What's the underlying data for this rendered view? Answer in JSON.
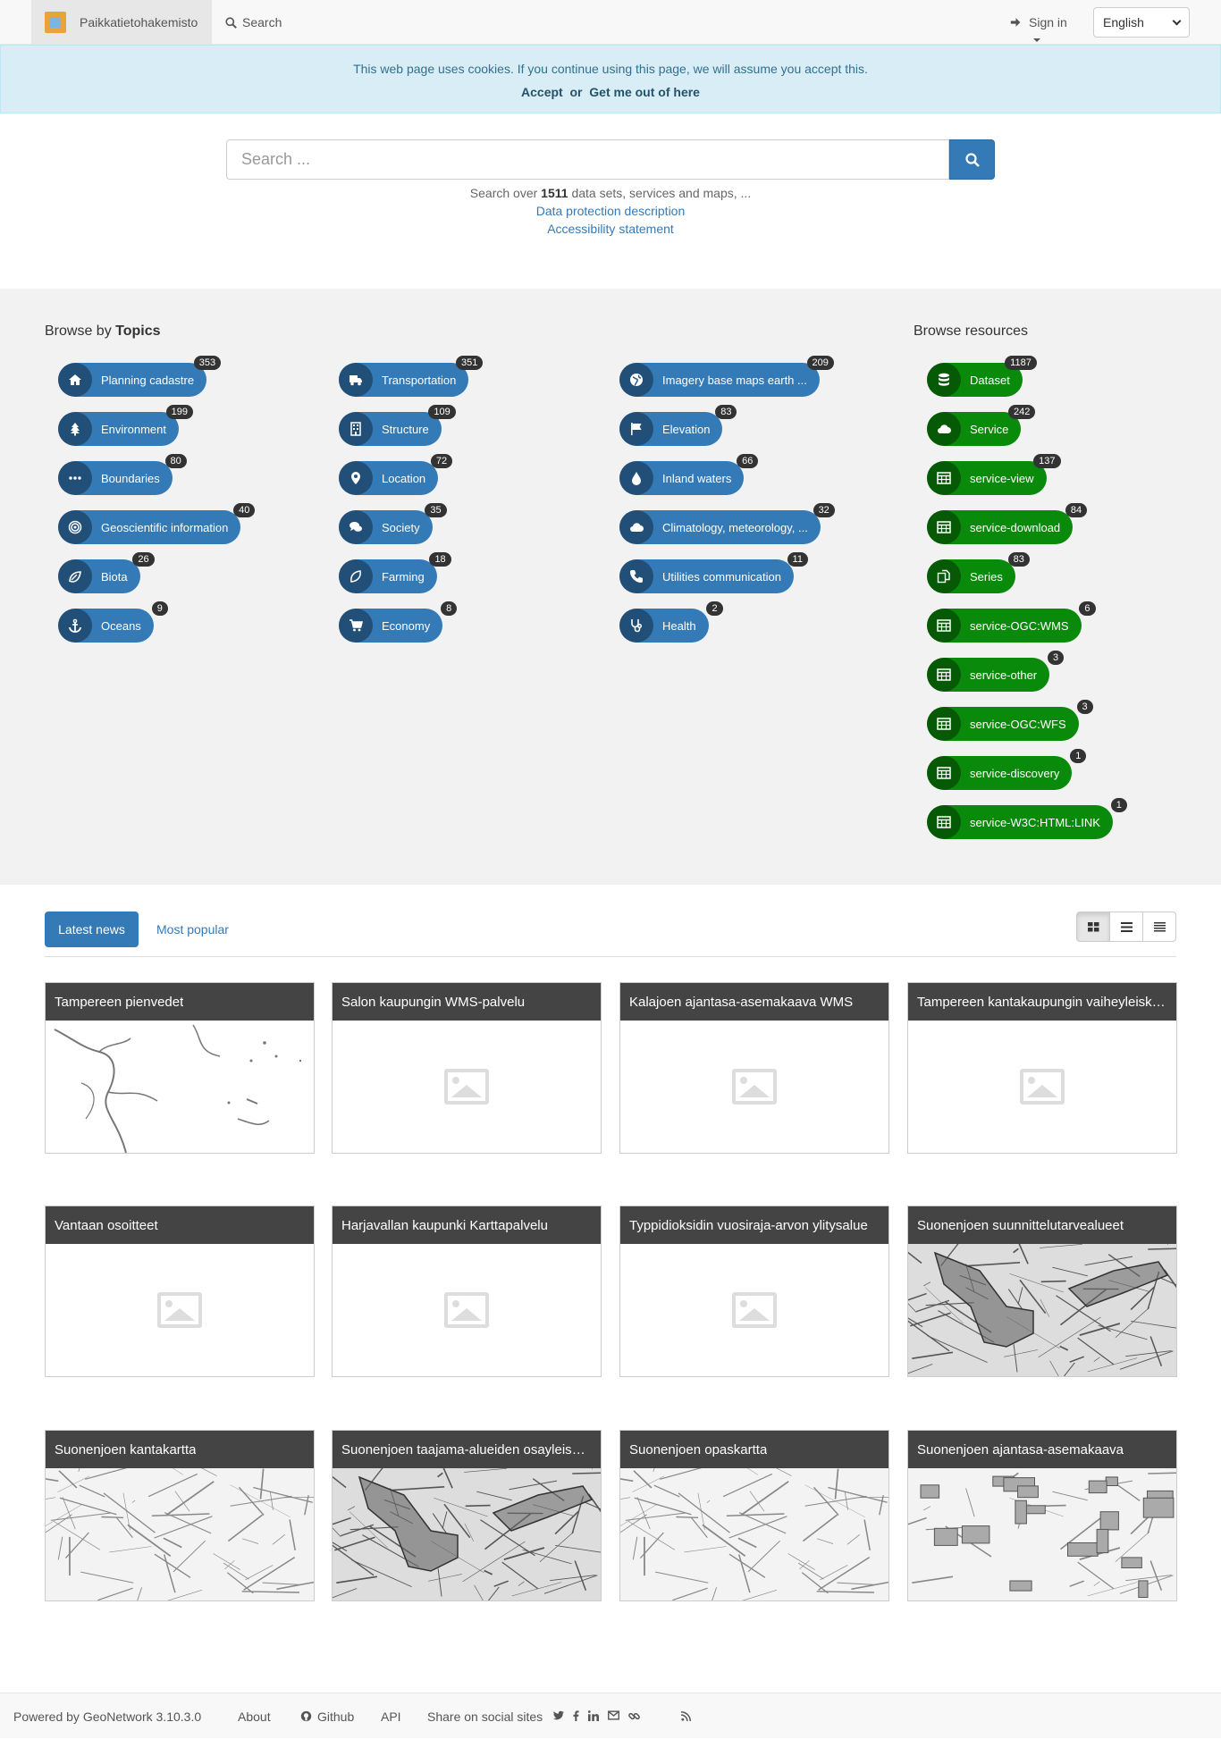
{
  "navbar": {
    "brand": "Paikkatietohakemisto",
    "search": "Search",
    "signin": "Sign in",
    "language": "English"
  },
  "cookie": {
    "message": "This web page uses cookies. If you continue using this page, we will assume you accept this.",
    "accept": "Accept",
    "or": "or",
    "leave": "Get me out of here"
  },
  "search": {
    "placeholder": "Search ...",
    "info_prefix": "Search over",
    "info_count": "1511",
    "info_suffix": "data sets, services and maps, ...",
    "data_protection": "Data protection description",
    "accessibility": "Accessibility statement"
  },
  "topics": {
    "title_prefix": "Browse by",
    "title_bold": "Topics",
    "items": [
      {
        "label": "Planning cadastre",
        "count": "353",
        "icon": "home-icon"
      },
      {
        "label": "Environment",
        "count": "199",
        "icon": "tree-icon"
      },
      {
        "label": "Boundaries",
        "count": "80",
        "icon": "dots-icon"
      },
      {
        "label": "Geoscientific information",
        "count": "40",
        "icon": "target-icon"
      },
      {
        "label": "Biota",
        "count": "26",
        "icon": "leaf-icon"
      },
      {
        "label": "Oceans",
        "count": "9",
        "icon": "anchor-icon"
      },
      {
        "label": "Transportation",
        "count": "351",
        "icon": "truck-icon"
      },
      {
        "label": "Structure",
        "count": "109",
        "icon": "building-icon"
      },
      {
        "label": "Location",
        "count": "72",
        "icon": "map-marker-icon"
      },
      {
        "label": "Society",
        "count": "35",
        "icon": "comments-icon"
      },
      {
        "label": "Farming",
        "count": "18",
        "icon": "field-icon"
      },
      {
        "label": "Economy",
        "count": "8",
        "icon": "cart-icon"
      },
      {
        "label": "Imagery base maps earth ...",
        "count": "209",
        "icon": "globe-icon"
      },
      {
        "label": "Elevation",
        "count": "83",
        "icon": "flag-icon"
      },
      {
        "label": "Inland waters",
        "count": "66",
        "icon": "drop-icon"
      },
      {
        "label": "Climatology, meteorology, ...",
        "count": "32",
        "icon": "cloud-icon"
      },
      {
        "label": "Utilities communication",
        "count": "11",
        "icon": "phone-icon"
      },
      {
        "label": "Health",
        "count": "2",
        "icon": "stethoscope-icon"
      }
    ]
  },
  "resources": {
    "title": "Browse resources",
    "items": [
      {
        "label": "Dataset",
        "count": "1187",
        "icon": "database-icon"
      },
      {
        "label": "Service",
        "count": "242",
        "icon": "cloud-icon"
      },
      {
        "label": "service-view",
        "count": "137",
        "icon": "table-icon"
      },
      {
        "label": "service-download",
        "count": "84",
        "icon": "table-icon"
      },
      {
        "label": "Series",
        "count": "83",
        "icon": "copy-icon"
      },
      {
        "label": "service-OGC:WMS",
        "count": "6",
        "icon": "table-icon"
      },
      {
        "label": "service-other",
        "count": "3",
        "icon": "table-icon"
      },
      {
        "label": "service-OGC:WFS",
        "count": "3",
        "icon": "table-icon"
      },
      {
        "label": "service-discovery",
        "count": "1",
        "icon": "table-icon"
      },
      {
        "label": "service-W3C:HTML:LINK",
        "count": "1",
        "icon": "table-icon"
      }
    ]
  },
  "tabs": {
    "latest": "Latest news",
    "popular": "Most popular"
  },
  "cards": [
    {
      "title": "Tampereen pienvedet",
      "thumb": "rivers"
    },
    {
      "title": "Salon kaupungin WMS-palvelu",
      "thumb": "placeholder"
    },
    {
      "title": "Kalajoen ajantasa-asemakaava WMS",
      "thumb": "placeholder"
    },
    {
      "title": "Tampereen kantakaupungin vaiheyleiskaava",
      "thumb": "placeholder"
    },
    {
      "title": "Vantaan osoitteet",
      "thumb": "placeholder"
    },
    {
      "title": "Harjavallan kaupunki Karttapalvelu",
      "thumb": "placeholder"
    },
    {
      "title": "Typpidioksidin vuosiraja-arvon ylitysalue",
      "thumb": "placeholder"
    },
    {
      "title": "Suonenjoen suunnittelutarvealueet",
      "thumb": "map-dark"
    },
    {
      "title": "Suonenjoen kantakartta",
      "thumb": "map-light"
    },
    {
      "title": "Suonenjoen taajama-alueiden osayleiskaava",
      "thumb": "map-dark"
    },
    {
      "title": "Suonenjoen opaskartta",
      "thumb": "map-light"
    },
    {
      "title": "Suonenjoen ajantasa-asemakaava",
      "thumb": "map-plan"
    }
  ],
  "footer": {
    "powered": "Powered by GeoNetwork 3.10.3.0",
    "about": "About",
    "github": "Github",
    "api": "API",
    "share": "Share on social sites"
  }
}
